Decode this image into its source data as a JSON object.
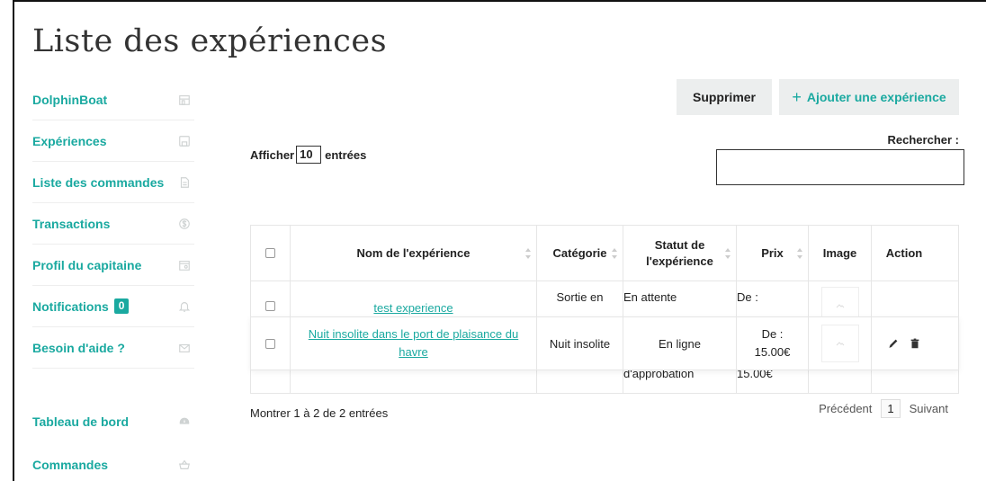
{
  "page": {
    "title": "Liste des expériences"
  },
  "sidebar": {
    "items": [
      {
        "label": "DolphinBoat",
        "icon": "store-icon"
      },
      {
        "label": "Expériences",
        "icon": "floppy-icon"
      },
      {
        "label": "Liste des commandes",
        "icon": "document-icon"
      },
      {
        "label": "Transactions",
        "icon": "dollar-icon"
      },
      {
        "label": "Profil du capitaine",
        "icon": "id-card-icon"
      },
      {
        "label": "Notifications",
        "badge": "0",
        "icon": "bell-icon"
      },
      {
        "label": "Besoin d'aide ?",
        "icon": "envelope-icon"
      },
      {
        "label": "Tableau de bord",
        "icon": "dashboard-icon"
      },
      {
        "label": "Commandes",
        "icon": "basket-icon"
      }
    ]
  },
  "toolbar": {
    "delete_label": "Supprimer",
    "add_label": "Ajouter une expérience"
  },
  "table_controls": {
    "show_prefix": "Afficher",
    "page_length": "10",
    "show_suffix": "entrées",
    "search_label": "Rechercher :",
    "search_value": ""
  },
  "table": {
    "headers": {
      "name": "Nom de l'expérience",
      "category": "Catégorie",
      "status": "Statut de l'expérience",
      "price": "Prix",
      "image": "Image",
      "action": "Action"
    },
    "rows": [
      {
        "name": "test experience",
        "name_tail": "havre",
        "category": "Sortie en",
        "status": "En attente",
        "status_tail": "d'approbation",
        "price_prefix": "De :",
        "price_tail": "15.00€"
      },
      {
        "name": "Nuit insolite dans le port de plaisance du havre",
        "category": "Nuit insolite",
        "status": "En ligne",
        "price_prefix": "De :",
        "price": "15.00€"
      }
    ]
  },
  "footer": {
    "info": "Montrer 1 à 2 de 2 entrées",
    "prev": "Précédent",
    "page": "1",
    "next": "Suivant"
  },
  "colors": {
    "accent": "#1aa9a0",
    "button_bg": "#eceeee"
  }
}
